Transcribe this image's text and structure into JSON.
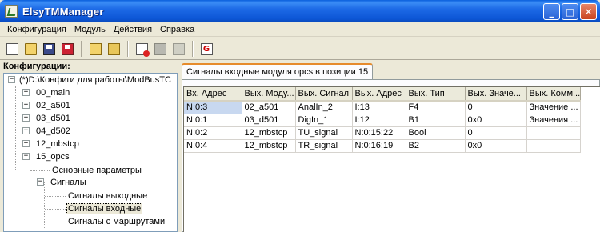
{
  "window": {
    "title": "ElsyTMManager"
  },
  "menu": [
    "Конфигурация",
    "Модуль",
    "Действия",
    "Справка"
  ],
  "toolbar": {
    "buttons": [
      {
        "icon": "new-file-icon"
      },
      {
        "icon": "open-file-icon"
      },
      {
        "icon": "save-icon"
      },
      {
        "icon": "save-as-icon"
      },
      {
        "icon": "folder-open-icon"
      },
      {
        "icon": "folders-icon"
      },
      {
        "icon": "add-module-icon"
      },
      {
        "icon": "delete-icon"
      },
      {
        "icon": "edit-icon"
      },
      {
        "icon": "generate-icon"
      }
    ]
  },
  "tree": {
    "header": "Конфигурации:",
    "root": "(*)D:\\Конфиги для работы\\ModBusTC",
    "nodes": [
      "00_main",
      "02_a501",
      "03_d501",
      "04_d502",
      "12_mbstcp",
      "15_opcs"
    ],
    "opcs_children": {
      "params": "Основные параметры",
      "signals": "Сигналы",
      "signals_out": "Сигналы выходные",
      "signals_in": "Сигналы входные",
      "signals_routes": "Сигналы с маршрутами"
    }
  },
  "tab": {
    "title": "Сигналы входные модуля opcs в позиции 15"
  },
  "table": {
    "columns": [
      "Вх. Адрес",
      "Вых. Моду...",
      "Вых. Сигнал",
      "Вых. Адрес",
      "Вых. Тип",
      "Вых. Значе...",
      "Вых. Комм..."
    ],
    "rows": [
      [
        "N:0:3",
        "02_a501",
        "AnalIn_2",
        "I:13",
        "F4",
        "0",
        "Значение ..."
      ],
      [
        "N:0:1",
        "03_d501",
        "DigIn_1",
        "I:12",
        "B1",
        "0x0",
        "Значения ..."
      ],
      [
        "N:0:2",
        "12_mbstcp",
        "TU_signal",
        "N:0:15:22",
        "Bool",
        "0",
        ""
      ],
      [
        "N:0:4",
        "12_mbstcp",
        "TR_signal",
        "N:0:16:19",
        "B2",
        "0x0",
        ""
      ]
    ]
  }
}
